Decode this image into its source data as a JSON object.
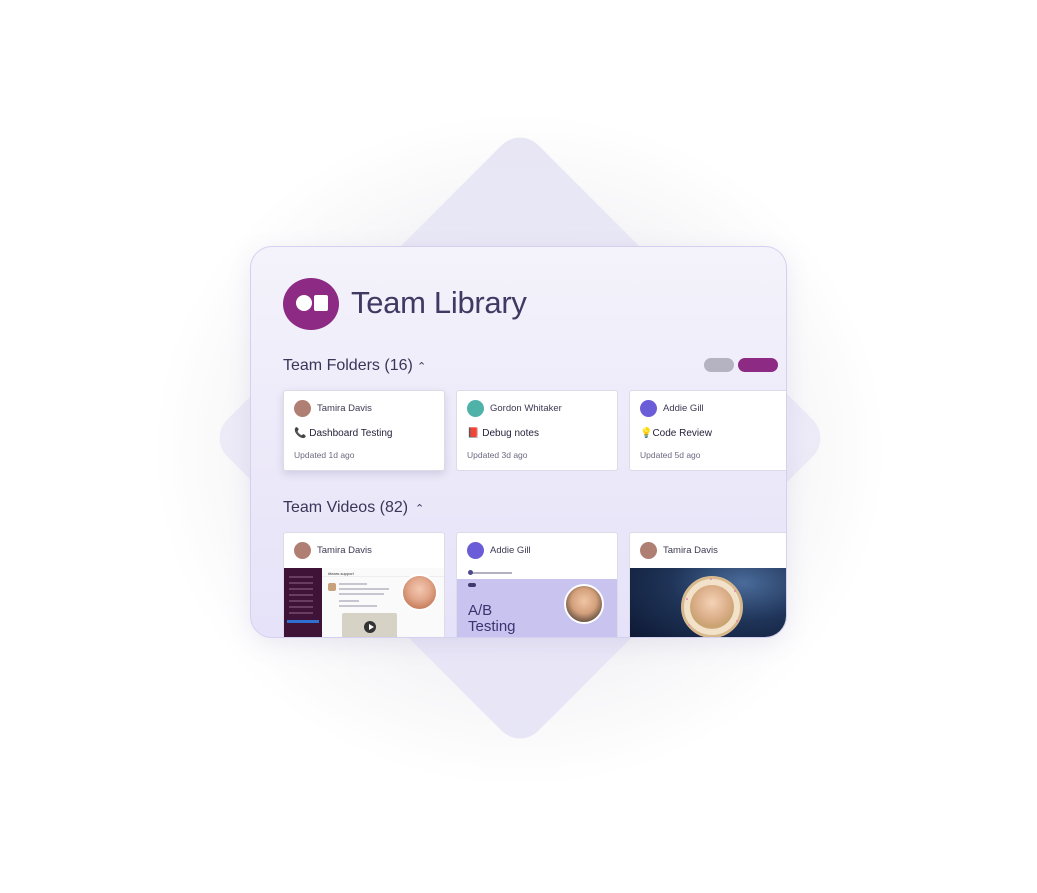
{
  "app": {
    "title": "Team Library",
    "brand_color": "#8c2a84",
    "logo_icon": "brand-logo-icon"
  },
  "folders_section": {
    "title": "Team Folders (16)",
    "caret": "⌃",
    "items": [
      {
        "author": "Tamira Davis",
        "icon": "📞",
        "name": "Dashboard Testing",
        "updated": "Updated 1d ago",
        "avatar_color": "#b07f73"
      },
      {
        "author": "Gordon Whitaker",
        "icon": "📕",
        "name": "Debug notes",
        "updated": "Updated 3d ago",
        "avatar_color": "#4fb2a8"
      },
      {
        "author": "Addie Gill",
        "icon": "💡",
        "name": "Code Review",
        "updated": "Updated 5d ago",
        "avatar_color": "#6b5cd8"
      }
    ]
  },
  "videos_section": {
    "title": "Team Videos (82)",
    "caret": "⌃",
    "items": [
      {
        "author": "Tamira Davis",
        "avatar_color": "#b07f73",
        "channel": "#team-support"
      },
      {
        "author": "Addie Gill",
        "avatar_color": "#6b5cd8",
        "thumb_text_1": "A/B",
        "thumb_text_2": "Testing"
      },
      {
        "author": "Tamira Davis",
        "avatar_color": "#b07f73"
      }
    ]
  }
}
